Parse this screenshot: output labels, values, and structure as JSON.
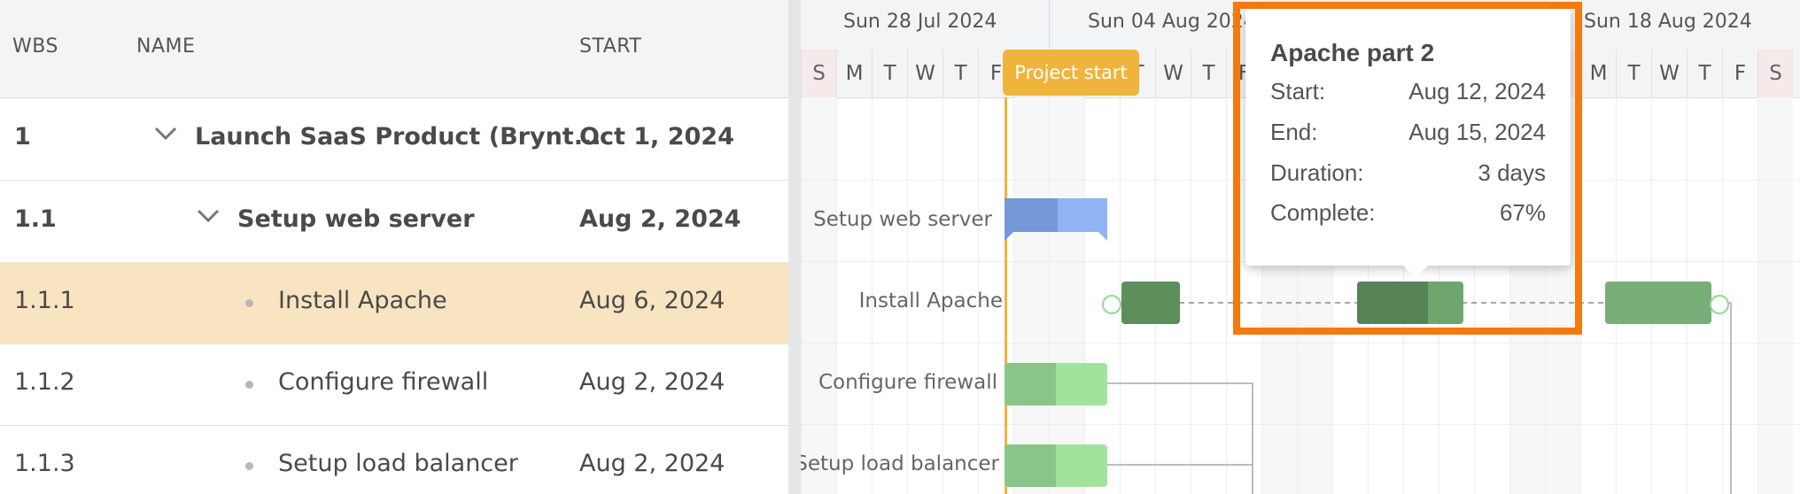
{
  "grid": {
    "headers": {
      "wbs": "WBS",
      "name": "NAME",
      "start": "START"
    },
    "rows": [
      {
        "wbs": "1",
        "name": "Launch SaaS Product (Brynt...",
        "start": "Oct 1, 2024"
      },
      {
        "wbs": "1.1",
        "name": "Setup web server",
        "start": "Aug 2, 2024"
      },
      {
        "wbs": "1.1.1",
        "name": "Install Apache",
        "start": "Aug 6, 2024"
      },
      {
        "wbs": "1.1.2",
        "name": "Configure firewall",
        "start": "Aug 2, 2024"
      },
      {
        "wbs": "1.1.3",
        "name": "Setup load balancer",
        "start": "Aug 2, 2024"
      }
    ]
  },
  "timeline": {
    "weeks": [
      "Sun 28 Jul 2024",
      "Sun 04 Aug 2024",
      "Sun 18 Aug 2024"
    ],
    "days": [
      "S",
      "M",
      "T",
      "W",
      "T",
      "F",
      "S",
      "S",
      "M",
      "T",
      "W",
      "T",
      "F",
      "S",
      "S",
      "M",
      "T",
      "W",
      "T",
      "F",
      "S",
      "S",
      "M",
      "T",
      "W",
      "T",
      "F",
      "S"
    ],
    "project_start_label": "Project start",
    "task_labels": {
      "setup_web_server": "Setup web server",
      "install_apache": "Install Apache",
      "configure_firewall": "Configure firewall",
      "setup_load_balancer": "Setup load balancer"
    }
  },
  "tooltip": {
    "title": "Apache part 2",
    "start_label": "Start:",
    "start_value": "Aug 12, 2024",
    "end_label": "End:",
    "end_value": "Aug 15, 2024",
    "duration_label": "Duration:",
    "duration_value": "3 days",
    "complete_label": "Complete:",
    "complete_value": "67%"
  },
  "colors": {
    "highlight": "#f47a10",
    "project_start": "#f0b43c",
    "selected_row": "#f9e4c1",
    "parent_bar": "#8fb3f5",
    "apache_bar": "#5c8f5c",
    "leaf_bar": "#a3e29d"
  }
}
